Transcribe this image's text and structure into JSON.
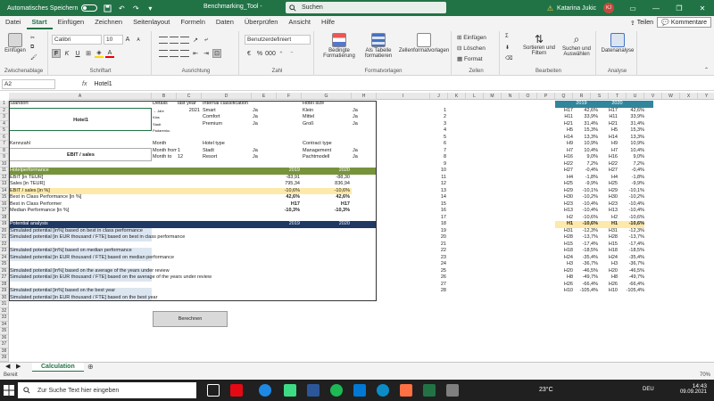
{
  "titlebar": {
    "autosave_label": "Automatisches Speichern",
    "autosave_state": "off",
    "doc_title": "Benchmarking_Tool -",
    "search_placeholder": "Suchen",
    "warning": "⚠",
    "user_name": "Katarina Jukic",
    "user_initials": "KJ"
  },
  "ribbon_tabs": [
    "Datei",
    "Start",
    "Einfügen",
    "Zeichnen",
    "Seitenlayout",
    "Formeln",
    "Daten",
    "Überprüfen",
    "Ansicht",
    "Hilfe"
  ],
  "active_tab": "Start",
  "share_label": "Teilen",
  "comments_label": "Kommentare",
  "ribbon": {
    "clipboard": {
      "paste": "Einfügen",
      "label": "Zwischenablage"
    },
    "font": {
      "name": "Calibri",
      "size": "10",
      "label": "Schriftart"
    },
    "alignment": {
      "label": "Ausrichtung"
    },
    "number": {
      "format": "Benutzerdefiniert",
      "label": "Zahl"
    },
    "styles": {
      "conditional": "Bedingte Formatierung",
      "as_table": "Als Tabelle formatieren",
      "cell_styles": "Zellenformatvorlagen",
      "label": "Formatvorlagen"
    },
    "cells": {
      "insert": "Einfügen",
      "delete": "Löschen",
      "format": "Format",
      "label": "Zellen"
    },
    "editing": {
      "sort": "Sortieren und Filtern",
      "find": "Suchen und Auswählen",
      "label": "Bearbeiten"
    },
    "analysis": {
      "data_analysis": "Datenanalyse",
      "label": "Analyse"
    }
  },
  "formula_bar": {
    "name_box": "A2",
    "fx": "fx",
    "content": "Hotel1"
  },
  "col_headers_left": [
    "A",
    "B",
    "C",
    "D",
    "E",
    "F",
    "G",
    "H",
    "I"
  ],
  "col_headers_right": [
    "J",
    "K",
    "L",
    "M",
    "N",
    "O",
    "P",
    "Q",
    "R",
    "S",
    "T",
    "U",
    "V",
    "W",
    "X",
    "Y",
    "Z",
    "AA",
    "AB"
  ],
  "row_numbers": [
    "1",
    "2",
    "3",
    "4",
    "5",
    "6",
    "7",
    "8",
    "9",
    "10",
    "11",
    "12",
    "13",
    "14",
    "15",
    "16",
    "17",
    "18",
    "19",
    "20",
    "21",
    "22",
    "23",
    "24",
    "25",
    "26",
    "27",
    "28",
    "29",
    "30",
    "31",
    "32",
    "33",
    "34",
    "35",
    "36",
    "37",
    "38",
    "39",
    "40"
  ],
  "left": {
    "standort": "Standort",
    "hotel": "Hotel1",
    "details": "Details",
    "last_year": "last year",
    "year_value": "2021",
    "jahr_label": "→ Jahr",
    "klas": "Klas",
    "stadt_small": "Stadt",
    "padarenku": "Padarenku",
    "internal_class": "Internal classification",
    "smart": "Smart",
    "comfort": "Comfort",
    "premium": "Premium",
    "ja": "Ja",
    "hotel_size": "Hotel size",
    "klein": "Klein",
    "mittel": "Mittel",
    "gross": "Groß",
    "kennzahl": "Kennzahl",
    "ebit_sales": "EBIT / sales",
    "month": "Month",
    "month_from": "Month from",
    "month_to": "Month to",
    "m_from": "1",
    "m_to": "12",
    "hotel_type": "Hotel type",
    "stadt": "Stadt",
    "resort": "Resort",
    "contract_type": "Contract type",
    "management": "Management",
    "pacht": "Pachtmodell",
    "perf_header": "Hotelperformance",
    "y2019": "2019",
    "y2020": "2020",
    "perf_rows": [
      {
        "label": "EBIT [in TEUR]",
        "v2019": "-83,91",
        "v2020": "-88,30"
      },
      {
        "label": "Sales [in TEUR]",
        "v2019": "795,34",
        "v2020": "836,94"
      },
      {
        "label": "EBIT / sales [in %]",
        "v2019": "-10,6%",
        "v2020": "-10,6%"
      },
      {
        "label": "Best in Class Performance [in %]",
        "v2019": "42,6%",
        "v2020": "42,6%"
      },
      {
        "label": "Best in Class Performer",
        "v2019": "H17",
        "v2020": "H17"
      },
      {
        "label": "Median Performance [in %]",
        "v2019": "-10,3%",
        "v2020": "-10,3%"
      }
    ],
    "analysis_header": "Potential analysis",
    "analysis_rows": [
      "Simulated potential [in%] based on best in class performance",
      "Simulated potential [in EUR thousand / FTE] based on best in class performance",
      "",
      "Simulated potential [in%] based on median performance",
      "Simulated potential [in EUR thousand / FTE] based on median performance",
      "",
      "Simulated potential [in%] based on the average of the years under review",
      "Simulated potential [in EUR thousand / FTE] based on the average of the years under review",
      "",
      "Simulated potential [in%] based on the best year",
      "Simulated potential [in EUR thousand / FTE] based on the best year"
    ],
    "calc_button": "Berechnen"
  },
  "right": {
    "header_2019": "2019",
    "header_2020": "2020",
    "rows": [
      [
        "1",
        "H17",
        "42,6%",
        "H17",
        "42,6%"
      ],
      [
        "2",
        "H11",
        "33,9%",
        "H11",
        "33,9%"
      ],
      [
        "3",
        "H21",
        "31,4%",
        "H21",
        "31,4%"
      ],
      [
        "4",
        "H5",
        "15,3%",
        "H5",
        "15,3%"
      ],
      [
        "5",
        "H14",
        "13,3%",
        "H14",
        "13,3%"
      ],
      [
        "6",
        "H9",
        "10,9%",
        "H9",
        "10,9%"
      ],
      [
        "7",
        "H7",
        "10,4%",
        "H7",
        "10,4%"
      ],
      [
        "8",
        "H16",
        "9,0%",
        "H16",
        "9,0%"
      ],
      [
        "9",
        "H22",
        "7,2%",
        "H22",
        "7,2%"
      ],
      [
        "10",
        "H27",
        "-0,4%",
        "H27",
        "-0,4%"
      ],
      [
        "11",
        "H4",
        "-1,8%",
        "H4",
        "-1,8%"
      ],
      [
        "12",
        "H25",
        "-9,9%",
        "H25",
        "-9,9%"
      ],
      [
        "13",
        "H29",
        "-10,1%",
        "H29",
        "-10,1%"
      ],
      [
        "14",
        "H30",
        "-10,2%",
        "H30",
        "-10,2%"
      ],
      [
        "15",
        "H23",
        "-10,4%",
        "H23",
        "-10,4%"
      ],
      [
        "16",
        "H13",
        "-10,4%",
        "H13",
        "-10,4%"
      ],
      [
        "17",
        "H2",
        "-10,6%",
        "H2",
        "-10,6%"
      ],
      [
        "18",
        "H1",
        "-10,6%",
        "H1",
        "-10,6%"
      ],
      [
        "19",
        "H31",
        "-12,3%",
        "H31",
        "-12,3%"
      ],
      [
        "20",
        "H28",
        "-13,7%",
        "H28",
        "-13,7%"
      ],
      [
        "21",
        "H15",
        "-17,4%",
        "H15",
        "-17,4%"
      ],
      [
        "22",
        "H18",
        "-18,5%",
        "H18",
        "-18,5%"
      ],
      [
        "23",
        "H24",
        "-35,4%",
        "H24",
        "-35,4%"
      ],
      [
        "24",
        "H3",
        "-36,7%",
        "H3",
        "-36,7%"
      ],
      [
        "25",
        "H20",
        "-46,5%",
        "H20",
        "-46,5%"
      ],
      [
        "26",
        "H8",
        "-49,7%",
        "H8",
        "-49,7%"
      ],
      [
        "27",
        "H26",
        "-66,4%",
        "H26",
        "-66,4%"
      ],
      [
        "28",
        "H10",
        "-105,4%",
        "H10",
        "-105,4%"
      ]
    ]
  },
  "sheet_tab": "Calculation",
  "status": {
    "ready": "Bereit",
    "zoom": "70%"
  },
  "taskbar": {
    "search": "Zur Suche Text hier eingeben",
    "temperature": "23°C",
    "lang": "DEU",
    "time": "14:43",
    "date": "09.09.2021"
  },
  "colors": {
    "excel_green": "#217346",
    "perf_green": "#76933c",
    "navy": "#1f3864",
    "teal": "#31869b",
    "yellow": "#fde9a9"
  }
}
